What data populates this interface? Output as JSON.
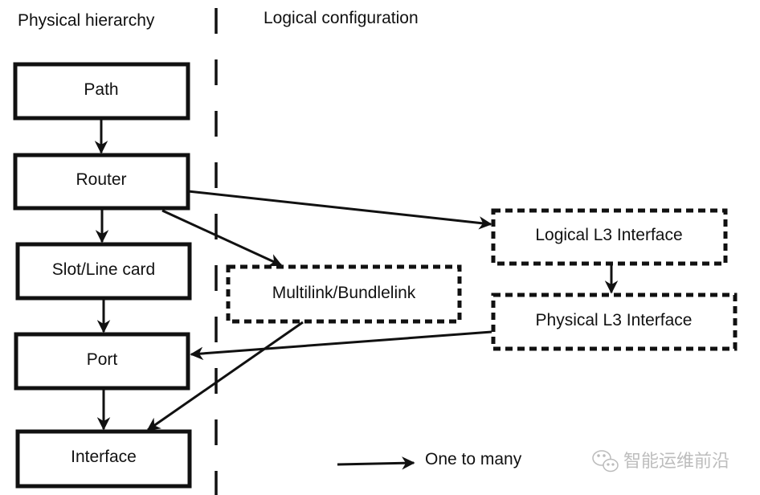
{
  "headings": {
    "left": "Physical hierarchy",
    "right": "Logical configuration"
  },
  "nodes": {
    "path": "Path",
    "router": "Router",
    "slot": "Slot/Line card",
    "port": "Port",
    "interface": "Interface",
    "multilink": "Multilink/Bundlelink",
    "logical_l3": "Logical L3 Interface",
    "physical_l3": "Physical L3 Interface"
  },
  "legend": {
    "label": "One to many",
    "icon": "arrow-right-icon"
  },
  "watermark": {
    "icon": "wechat-icon",
    "text": "智能运维前沿"
  },
  "edges": [
    {
      "from": "path",
      "to": "router",
      "type": "one-to-many"
    },
    {
      "from": "router",
      "to": "slot",
      "type": "one-to-many"
    },
    {
      "from": "slot",
      "to": "port",
      "type": "one-to-many"
    },
    {
      "from": "port",
      "to": "interface",
      "type": "one-to-many"
    },
    {
      "from": "router",
      "to": "logical_l3",
      "type": "one-to-many"
    },
    {
      "from": "router",
      "to": "multilink",
      "type": "one-to-many"
    },
    {
      "from": "logical_l3",
      "to": "physical_l3",
      "type": "one-to-many"
    },
    {
      "from": "physical_l3",
      "to": "port",
      "type": "one-to-many"
    },
    {
      "from": "multilink",
      "to": "interface",
      "type": "one-to-many"
    }
  ]
}
